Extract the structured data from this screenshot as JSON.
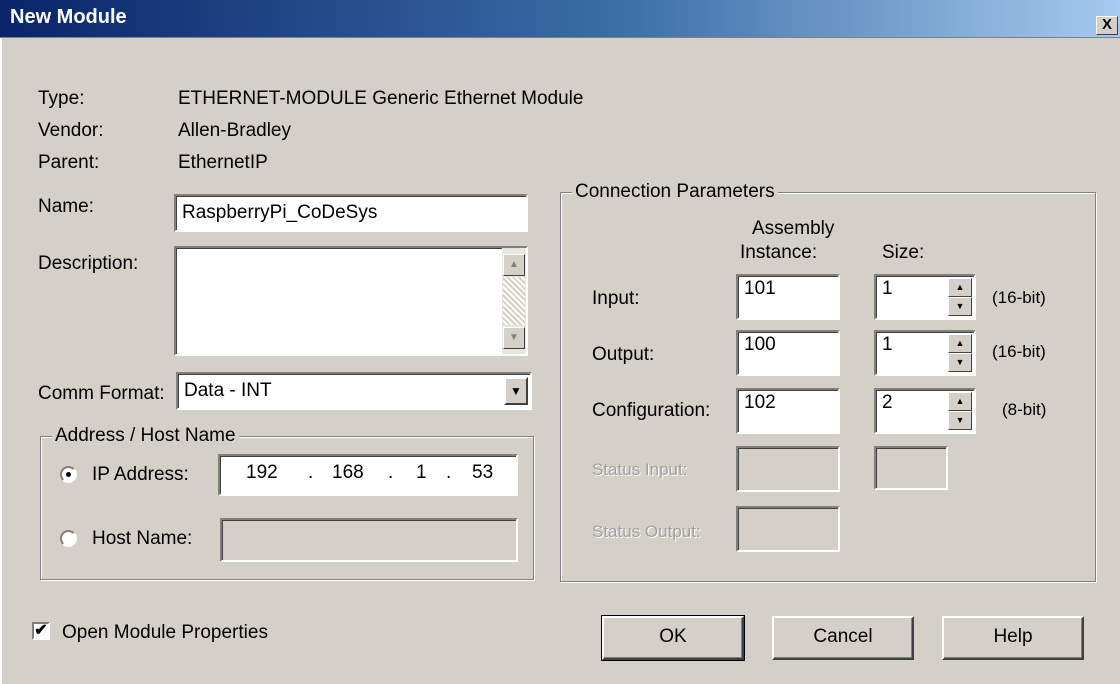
{
  "window": {
    "title": "New Module",
    "close_glyph": "X"
  },
  "module": {
    "type_label": "Type:",
    "type_value": "ETHERNET-MODULE Generic Ethernet Module",
    "vendor_label": "Vendor:",
    "vendor_value": "Allen-Bradley",
    "parent_label": "Parent:",
    "parent_value": "EthernetIP",
    "name_label": "Name:",
    "name_value": "RaspberryPi_CoDeSys",
    "description_label": "Description:",
    "description_value": "",
    "comm_format_label": "Comm Format:",
    "comm_format_value": "Data - INT"
  },
  "address": {
    "group_title": "Address / Host Name",
    "ip_label": "IP Address:",
    "ip_octets": [
      "192",
      "168",
      "1",
      "53"
    ],
    "ip_selected": true,
    "host_label": "Host Name:",
    "host_value": ""
  },
  "connection": {
    "group_title": "Connection Parameters",
    "col_assembly_line1": "Assembly",
    "col_assembly_line2": "Instance:",
    "col_size": "Size:",
    "rows": [
      {
        "label": "Input:",
        "instance": "101",
        "size": "1",
        "unit": "(16-bit)",
        "enabled": true
      },
      {
        "label": "Output:",
        "instance": "100",
        "size": "1",
        "unit": "(16-bit)",
        "enabled": true
      },
      {
        "label": "Configuration:",
        "instance": "102",
        "size": "2",
        "unit": "(8-bit)",
        "enabled": true
      },
      {
        "label": "Status Input:",
        "instance": "",
        "size": "",
        "unit": "",
        "enabled": false
      },
      {
        "label": "Status Output:",
        "instance": "",
        "size": "",
        "unit": "",
        "enabled": false
      }
    ]
  },
  "footer": {
    "open_properties_label": "Open Module Properties",
    "open_properties_checked": true,
    "check_glyph": "✔",
    "ok_label": "OK",
    "cancel_label": "Cancel",
    "help_label": "Help"
  }
}
